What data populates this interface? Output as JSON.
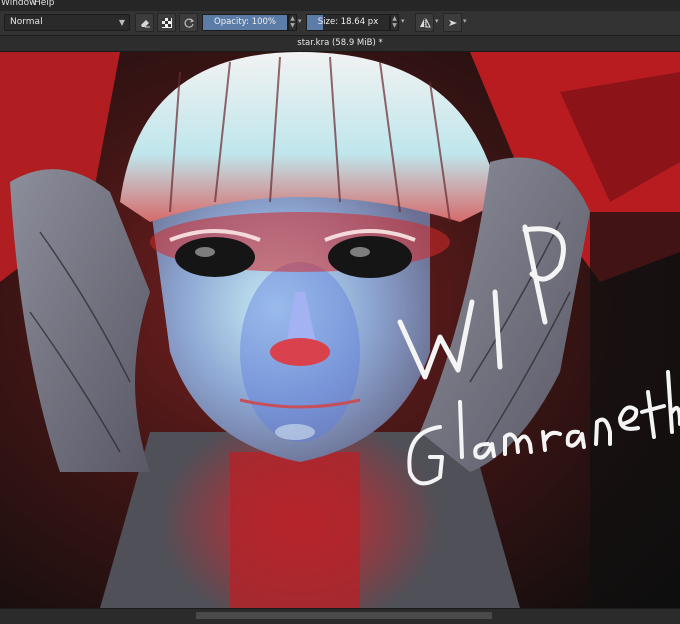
{
  "menubar": {
    "window": "Window",
    "help": "Help"
  },
  "toolbar": {
    "blend_mode": "Normal",
    "opacity_label": "Opacity:  100%",
    "opacity_value": 100,
    "size_label": "Size:  18.64 px",
    "size_level": 0.2
  },
  "document": {
    "title": "star.kra (58.9 MiB) *"
  },
  "artwork": {
    "wip": "WIP",
    "signature": "Glamraneth"
  },
  "colors": {
    "accent": "#5a7ca6",
    "bg": "#2b2b2b"
  }
}
